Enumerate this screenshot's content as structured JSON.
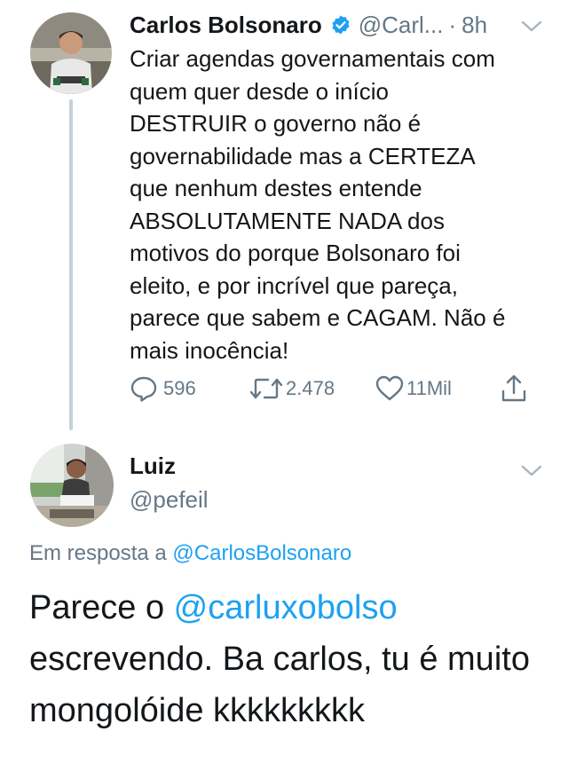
{
  "tweet": {
    "author_name": "Carlos Bolsonaro",
    "handle": "@Carl...",
    "separator": "·",
    "time": "8h",
    "text": "Criar agendas governamentais com\nquem quer desde o início\nDESTRUIR o governo não é\ngovernabilidade mas a CERTEZA\nque nenhum destes entende\nABSOLUTAMENTE NADA dos\nmotivos do porque Bolsonaro foi\neleito, e por incrível que pareça,\nparece que sabem e CAGAM. Não é\nmais inocência!",
    "replies_count": "596",
    "retweets_count": "2.478",
    "likes_count": "11Mil",
    "icons": [
      "verified-badge-icon",
      "chevron-down-icon",
      "reply-icon",
      "retweet-icon",
      "like-icon",
      "share-icon"
    ]
  },
  "reply": {
    "author_name": "Luiz",
    "handle": "@pefeil",
    "replying_prefix": "Em resposta a",
    "replying_to": "@CarlosBolsonaro",
    "text_before": "Parece o ",
    "mention": "@carluxobolso",
    "text_after": " escrevendo. Ba carlos, tu é muito mongolóide kkkkkkkkk"
  },
  "colors": {
    "text": "#14171a",
    "secondary": "#657786",
    "accent": "#1da1f2",
    "thread_line": "#c6d0d6"
  }
}
